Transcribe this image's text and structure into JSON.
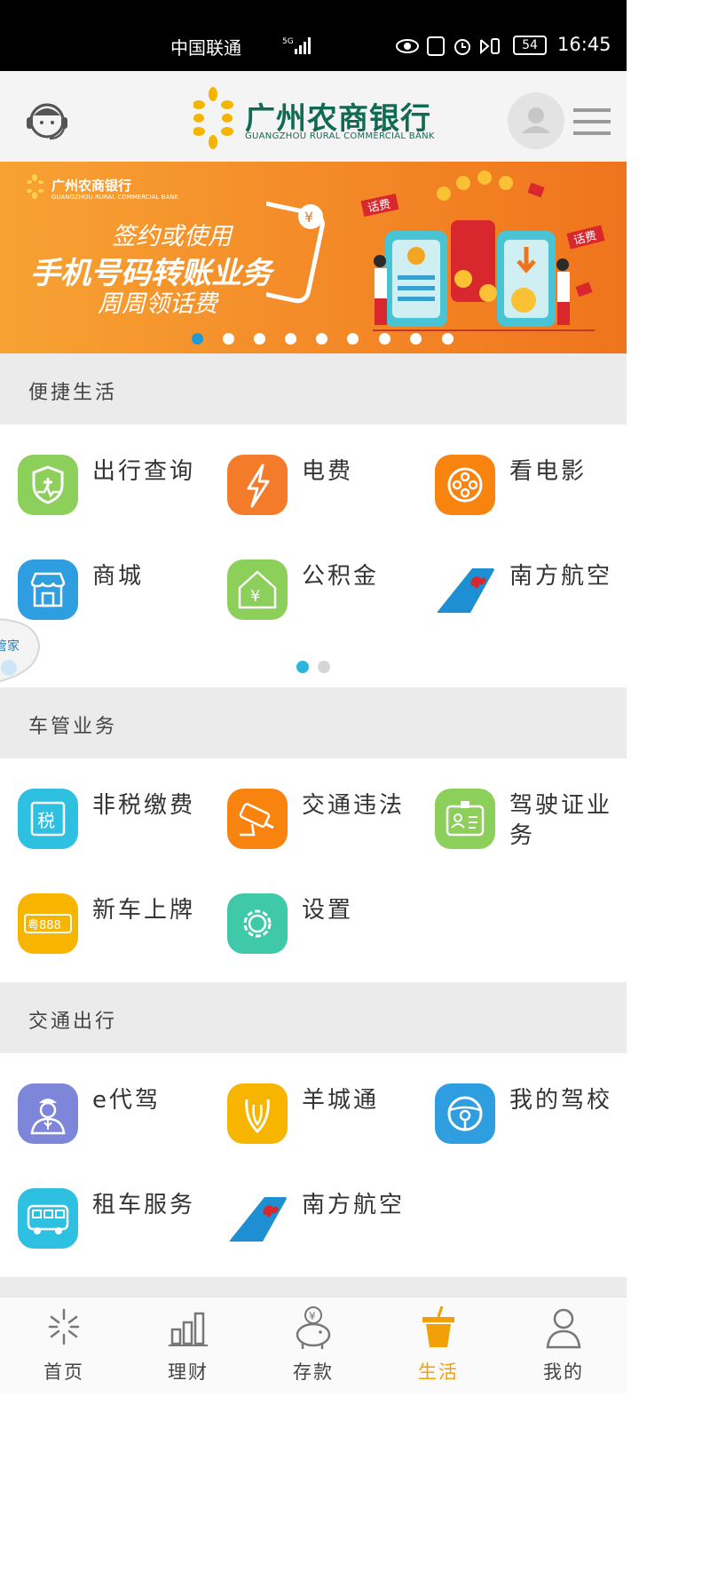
{
  "status_bar": {
    "carrier": "中国联通",
    "network": "5G",
    "battery": "54",
    "time": "16:45"
  },
  "header": {
    "bank_name_cn": "广州农商银行",
    "bank_name_en": "GUANGZHOU RURAL COMMERCIAL BANK"
  },
  "banner": {
    "logo_cn": "广州农商银行",
    "logo_en": "GUANGZHOU RURAL COMMERCIAL BANK",
    "line1": "签约或使用",
    "line2": "手机号码转账业务",
    "line3": "周周领话费",
    "tag": "话费",
    "slide_count": 9,
    "active_slide": 0
  },
  "sections": [
    {
      "title": "便捷生活",
      "items": [
        {
          "label": "出行查询",
          "icon": "shield-health-icon",
          "color": "#8ccf5a"
        },
        {
          "label": "电费",
          "icon": "lightning-icon",
          "color": "#f47b2a"
        },
        {
          "label": "看电影",
          "icon": "film-reel-icon",
          "color": "#f8830f"
        },
        {
          "label": "商城",
          "icon": "store-icon",
          "color": "#2e9ee0"
        },
        {
          "label": "公积金",
          "icon": "house-yuan-icon",
          "color": "#8ccf5a"
        },
        {
          "label": "南方航空",
          "icon": "china-southern-logo-icon",
          "color": "#1e8fd2"
        }
      ]
    },
    {
      "title": "车管业务",
      "items": [
        {
          "label": "非税缴费",
          "icon": "tax-icon",
          "color": "#2ec0e0"
        },
        {
          "label": "交通违法",
          "icon": "traffic-camera-icon",
          "color": "#f8830f"
        },
        {
          "label": "驾驶证业务",
          "icon": "id-card-icon",
          "color": "#8ccf5a"
        },
        {
          "label": "新车上牌",
          "icon": "license-plate-icon",
          "color": "#f7b500"
        },
        {
          "label": "设置",
          "icon": "gear-icon",
          "color": "#3fc9a9"
        }
      ]
    },
    {
      "title": "交通出行",
      "items": [
        {
          "label": "e代驾",
          "icon": "driver-icon",
          "color": "#7e86da"
        },
        {
          "label": "羊城通",
          "icon": "yangchengtong-icon",
          "color": "#f7b500"
        },
        {
          "label": "我的驾校",
          "icon": "steering-wheel-icon",
          "color": "#2e9ee0"
        },
        {
          "label": "租车服务",
          "icon": "bus-icon",
          "color": "#2ec0e0"
        },
        {
          "label": "南方航空",
          "icon": "china-southern-logo-icon",
          "color": "#1e8fd2"
        }
      ]
    }
  ],
  "assistant_label": "管家",
  "tabs": [
    {
      "label": "首页",
      "icon": "home-logo-icon"
    },
    {
      "label": "理财",
      "icon": "bar-chart-icon"
    },
    {
      "label": "存款",
      "icon": "piggy-bank-icon"
    },
    {
      "label": "生活",
      "icon": "drink-cup-icon",
      "active": true
    },
    {
      "label": "我的",
      "icon": "user-icon"
    }
  ],
  "colors": {
    "accent_active": "#f2a007",
    "brand_green": "#116b52",
    "pager_active": "#1e9bd7"
  }
}
